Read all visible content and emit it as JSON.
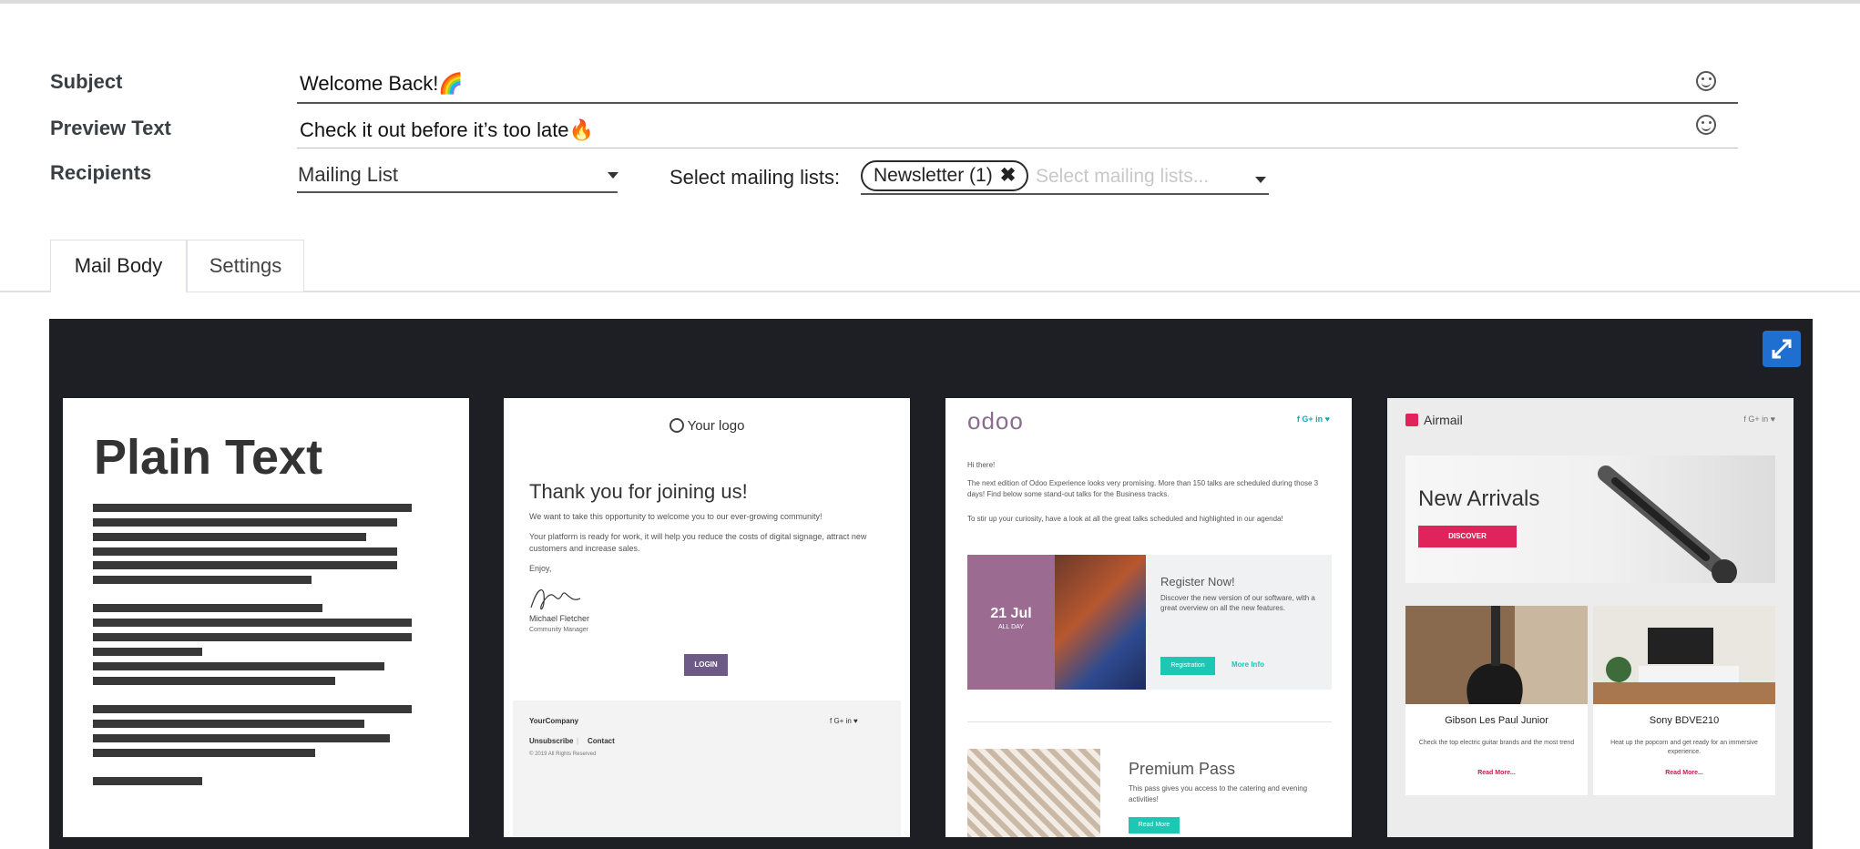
{
  "form": {
    "subject_label": "Subject",
    "subject_value": "Welcome Back!🌈",
    "preview_label": "Preview Text",
    "preview_value": "Check it out before it’s too late🔥",
    "recipients_label": "Recipients",
    "recipients_value": "Mailing List",
    "mailing_lists_label": "Select mailing lists:",
    "mailing_list_tag": "Newsletter (1)",
    "mailing_list_tag_remove": "✖",
    "mailing_lists_placeholder": "Select mailing lists..."
  },
  "tabs": [
    {
      "label": "Mail Body",
      "active": true
    },
    {
      "label": "Settings",
      "active": false
    }
  ],
  "templates": {
    "plain": {
      "title": "Plain Text"
    },
    "welcome": {
      "logo": "Your logo",
      "heading": "Thank you for joining us!",
      "p1": "We want to take this opportunity to welcome you to our ever-growing community!",
      "p2": "Your platform is ready for work, it will help you reduce the costs of digital signage, attract new customers and increase sales.",
      "p3": "Enjoy,",
      "signer": "Michael Fletcher",
      "role": "Community Manager",
      "button": "LOGIN",
      "company": "YourCompany",
      "unsubscribe": "Unsubscribe",
      "separator": "|",
      "contact": "Contact",
      "copyright": "© 2019 All Rights Reserved",
      "social": "f  G+  in  ♥"
    },
    "event": {
      "logo": "odoo",
      "social": "f G+ in ♥",
      "greeting": "Hi there!",
      "p1": "The next edition of Odoo Experience looks very promising. More than 150 talks are scheduled during those 3 days! Find below some stand-out talks for the Business tracks.",
      "p2": "To stir up your curiosity, have a look at all the great talks scheduled and highlighted in our agenda!",
      "date": "21 Jul",
      "date_sub": "ALL DAY",
      "card_title": "Register Now!",
      "card_text": "Discover the new version of our software, with a great overview on all the new features.",
      "register": "Registration",
      "more_info": "More Info",
      "pass_title": "Premium Pass",
      "pass_text": "This pass gives you access to the catering and evening activities!",
      "pass_button": "Read More"
    },
    "airmail": {
      "logo": "Airmail",
      "social": "f  G+  in  ♥",
      "hero_title": "New Arrivals",
      "hero_button": "DISCOVER",
      "products": [
        {
          "name": "Gibson Les Paul Junior",
          "desc": "Check the top electric guitar brands and the most trend",
          "link": "Read More..."
        },
        {
          "name": "Sony BDVE210",
          "desc": "Heat up the popcorn and get ready for an immersive experience.",
          "link": "Read More..."
        }
      ]
    }
  },
  "icons": {
    "emoji": "smiley-icon",
    "expand": "fullscreen-expand-icon",
    "dropdown": "caret-down-icon"
  },
  "colors": {
    "editor_bg": "#1e1f24",
    "expand_btn": "#1f6fd1",
    "odoo_purple": "#9b6b92",
    "teal": "#1ec7b3",
    "airmail_red": "#e0235a"
  }
}
